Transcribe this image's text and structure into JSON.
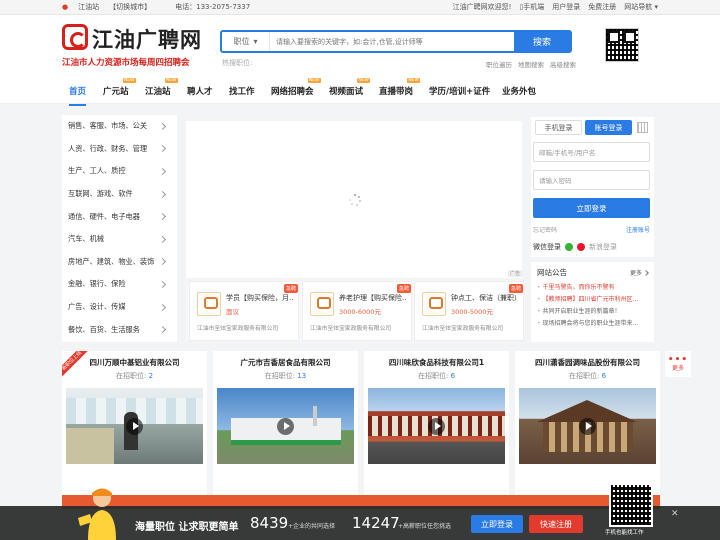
{
  "topbar": {
    "city": "江油站",
    "switch_city": "【切换城市】",
    "phone_label": "电话：133-2075-7337",
    "welcome": "江油广聘网欢迎您!",
    "mobile": "手机端",
    "login": "用户登录",
    "register": "免费注册",
    "nav": "网站导航"
  },
  "header": {
    "logo_name": "江油广聘网",
    "logo_sub": "江油市人力资源市场每周四招聘会"
  },
  "search": {
    "category": "职位",
    "placeholder": "请输入要搜索的关键字，如:会计,仓管,设计师等",
    "button": "搜索",
    "hot_label": "热搜职位:",
    "links": [
      "职位遍历",
      "地图搜索",
      "高级搜索"
    ]
  },
  "nav": [
    {
      "label": "首页",
      "new": false,
      "active": true
    },
    {
      "label": "广元站",
      "new": true
    },
    {
      "label": "江油站",
      "new": true
    },
    {
      "label": "聘人才",
      "new": false
    },
    {
      "label": "找工作",
      "new": false
    },
    {
      "label": "网络招聘会",
      "new": true
    },
    {
      "label": "视频面试",
      "new": true
    },
    {
      "label": "直播带岗",
      "new": true
    },
    {
      "label": "学历/培训+证件",
      "new": false
    },
    {
      "label": "业务外包",
      "new": false
    }
  ],
  "new_badge": "NEW",
  "categories": [
    "销售、客服、市场、公关",
    "人资、行政、财务、管理",
    "生产、工人、质控",
    "互联网、游戏、软件",
    "通信、硬件、电子电器",
    "汽车、机械",
    "房地产、建筑、物业、装饰",
    "金融、银行、保险",
    "广告、设计、传媒",
    "餐饮、百货、生活服务"
  ],
  "banner_ad": "广告",
  "featured_jobs": [
    {
      "tag": "急聘",
      "title": "学员【购买保险，月...",
      "salary": "面议",
      "company": "江油市至炫宝家政服务有限公司"
    },
    {
      "tag": "急聘",
      "title": "养老护理【购买保险...",
      "salary": "3000-6000元",
      "company": "江油市至炫宝家政服务有限公司"
    },
    {
      "tag": "急聘",
      "title": "钟点工、保洁（兼职）",
      "salary": "3000-5000元",
      "company": "江油市至炫宝家政服务有限公司"
    }
  ],
  "login": {
    "tab_phone": "手机登录",
    "tab_account": "账号登录",
    "user_placeholder": "邮箱/手机号/用户名",
    "pwd_placeholder": "请输入密码",
    "button": "立即登录",
    "forget": "忘记密码",
    "register": "注册账号",
    "wechat": "微信登录",
    "weibo": "新浪登录"
  },
  "notice": {
    "title": "网站公告",
    "more": "更多",
    "items": [
      "千里马警告，而你乐不警有",
      "【教师招聘】四川省广元市利州区...",
      "共同开启职业生涯的新篇章！",
      "现场招聘会将与您的职业生涯带来..."
    ]
  },
  "more_btn": "更多",
  "companies": [
    {
      "name": "四川万顺中基铝业有限公司",
      "label": "在招职位:",
      "count": "2",
      "ribbon": "新职位上线"
    },
    {
      "name": "广元市吉香居食品有限公司",
      "label": "在招职位:",
      "count": "13"
    },
    {
      "name": "四川味欣食品科技有限公司1",
      "label": "在招职位:",
      "count": "6"
    },
    {
      "name": "四川潇香园调味品股份有限公司",
      "label": "在招职位:",
      "count": "6"
    }
  ],
  "footer": {
    "slogan": "海量职位 让求职更简单",
    "num1": "8439",
    "num1_label": "+企业的共同选择",
    "num2": "14247",
    "num2_label": "+高薪职位任您挑选",
    "btn_post": "立即登录",
    "btn_reg": "快速注册",
    "qr_label": "手机也能找工作",
    "close": "✕"
  },
  "colors": {
    "brand_red": "#d8201a",
    "accent_blue": "#2a7be4",
    "orange_tag": "#f25a3a"
  }
}
